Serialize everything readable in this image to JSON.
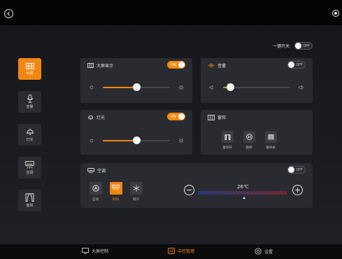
{
  "master": {
    "label": "一键开关",
    "toggle_text": "OFF",
    "on": false
  },
  "sidebar": {
    "items": [
      {
        "label": "大屏",
        "icon": "screen-icon",
        "active": true
      },
      {
        "label": "音量",
        "icon": "microphone-icon",
        "active": false
      },
      {
        "label": "灯光",
        "icon": "lamp-icon",
        "active": false
      },
      {
        "label": "空调",
        "icon": "air-conditioner-icon",
        "active": false
      },
      {
        "label": "窗帘",
        "icon": "curtain-icon",
        "active": false
      }
    ]
  },
  "screen_panel": {
    "title": "大屏显示",
    "toggle_text": "ON",
    "on": true,
    "level": 0.5
  },
  "volume_panel": {
    "title": "音量",
    "toggle_text": "OFF",
    "on": false,
    "level": 0.1
  },
  "light_panel": {
    "title": "灯光",
    "toggle_text": "ON",
    "on": true,
    "level": 0.5
  },
  "curtain_panel": {
    "title": "窗帘",
    "buttons": [
      {
        "label": "窗帘开",
        "icon": "curtain-open-icon"
      },
      {
        "label": "暂停",
        "icon": "pause-icon"
      },
      {
        "label": "窗帘关",
        "icon": "curtain-close-icon"
      }
    ]
  },
  "ac_panel": {
    "title": "空调",
    "toggle_text": "OFF",
    "on": false,
    "modes": [
      {
        "label": "自动",
        "icon": "auto-mode-icon",
        "active": false
      },
      {
        "label": "制热",
        "icon": "heat-mode-icon",
        "active": true
      },
      {
        "label": "制冷",
        "icon": "snowflake-icon",
        "active": false
      }
    ],
    "temperature": "26℃",
    "minus": "−",
    "plus": "+",
    "temperature_level": 0.52
  },
  "bottomnav": {
    "items": [
      {
        "label": "大屏控制",
        "icon": "monitor-icon",
        "active": false
      },
      {
        "label": "中控管理",
        "icon": "central-control-icon",
        "active": true
      },
      {
        "label": "设置",
        "icon": "gear-icon",
        "active": false
      }
    ]
  },
  "colors": {
    "accent": "#f28613",
    "panel": "#2a2b30",
    "background": "#1b1c21"
  }
}
